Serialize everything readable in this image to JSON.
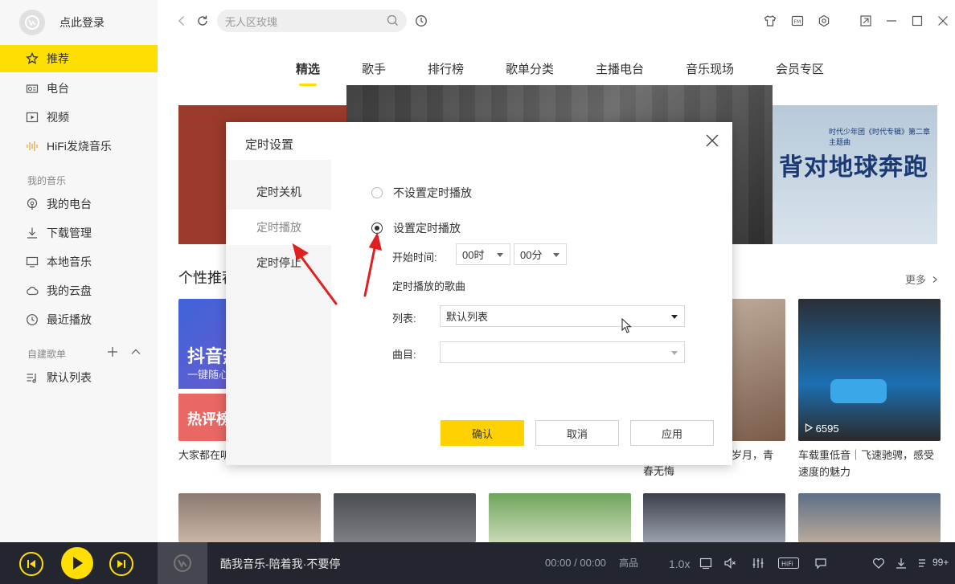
{
  "sidebar": {
    "login_text": "点此登录",
    "nav": [
      {
        "label": "推荐",
        "icon": "star-icon"
      },
      {
        "label": "电台",
        "icon": "radio-icon"
      },
      {
        "label": "视频",
        "icon": "video-icon"
      },
      {
        "label": "HiFi发烧音乐",
        "icon": "waveform-icon"
      }
    ],
    "my_music_label": "我的音乐",
    "my_music": [
      {
        "label": "我的电台",
        "icon": "podcast-icon"
      },
      {
        "label": "下载管理",
        "icon": "download-icon"
      },
      {
        "label": "本地音乐",
        "icon": "monitor-icon"
      },
      {
        "label": "我的云盘",
        "icon": "cloud-icon"
      },
      {
        "label": "最近播放",
        "icon": "clock-icon"
      }
    ],
    "playlist_label": "自建歌单",
    "playlists": [
      {
        "label": "默认列表",
        "icon": "playlist-icon"
      }
    ]
  },
  "search": {
    "placeholder": "无人区玫瑰"
  },
  "tabs": [
    "精选",
    "歌手",
    "排行榜",
    "歌单分类",
    "主播电台",
    "音乐现场",
    "会员专区"
  ],
  "banners": {
    "right_title": "背对地球奔跑",
    "right_sub": "时代少年团《时代专辑》第二章 主题曲"
  },
  "section": {
    "title": "个性推荐",
    "more": "更多"
  },
  "cards": {
    "card1_text1": "抖音热",
    "card1_text2": "一键随心",
    "card1_text3": "热评榜",
    "card1_caption": "大家都在听",
    "card4_caption_1": "岁月，青",
    "card4_caption_2": "春无悔",
    "card5_playcount": "6595",
    "card5_caption": "车载重低音｜飞速驰骋，感受速度的魅力"
  },
  "dialog": {
    "title": "定时设置",
    "side": [
      "定时关机",
      "定时播放",
      "定时停止"
    ],
    "opt_none": "不设置定时播放",
    "opt_set": "设置定时播放",
    "start_label": "开始时间:",
    "hour": "00时",
    "minute": "00分",
    "songs_label": "定时播放的歌曲",
    "list_label": "列表:",
    "list_value": "默认列表",
    "track_label": "曲目:",
    "track_value": "",
    "confirm": "确认",
    "cancel": "取消",
    "apply": "应用"
  },
  "player": {
    "now_playing": "酷我音乐-陪着我·不要停",
    "time": "00:00 / 00:00",
    "quality": "高品",
    "speed": "1.0x",
    "count": "99+"
  },
  "colors": {
    "accent": "#ffde03",
    "player_bg": "#23262f"
  }
}
